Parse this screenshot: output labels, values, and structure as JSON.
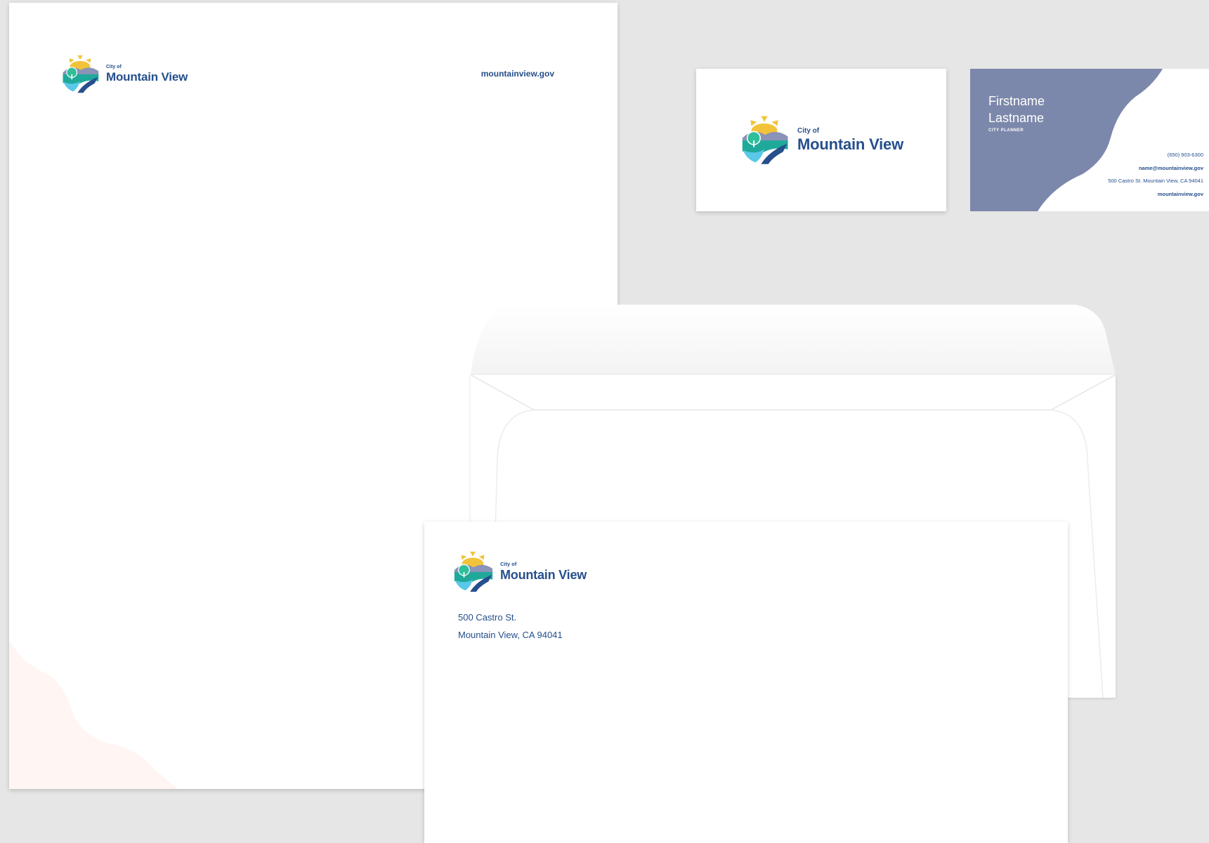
{
  "brand": {
    "city_of": "City of",
    "name": "Mountain View",
    "colors": {
      "navy": "#264f8c",
      "slate": "#7c88ab",
      "yellow": "#f2c33a",
      "teal": "#1fa99a",
      "sky": "#5ac8e8"
    },
    "logo_icon": "sun-mountain-tree-road-icon"
  },
  "letterhead": {
    "website": "mountainview.gov"
  },
  "business_card": {
    "name_line1": "Firstname",
    "name_line2": "Lastname",
    "job_title": "CITY PLANNER",
    "phone": "(650) 903-6300",
    "email": "name@mountainview.gov",
    "address": "500 Castro St. Mountain View, CA 94041",
    "website": "mountainview.gov"
  },
  "envelope": {
    "address_line1": "500 Castro St.",
    "address_line2": "Mountain View, CA 94041"
  }
}
